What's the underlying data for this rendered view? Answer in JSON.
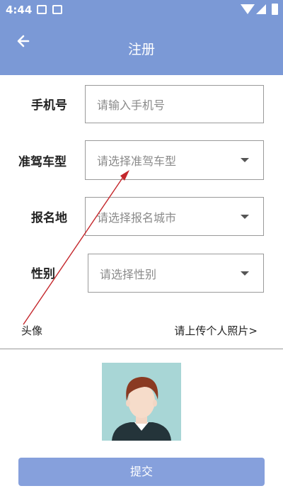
{
  "status_bar": {
    "time": "4:44"
  },
  "header": {
    "title": "注册"
  },
  "form": {
    "phone": {
      "label": "手机号",
      "placeholder": "请输入手机号"
    },
    "license": {
      "label": "准驾车型",
      "placeholder": "请选择准驾车型"
    },
    "city": {
      "label": "报名地",
      "placeholder": "请选择报名城市"
    },
    "gender": {
      "label": "性别",
      "placeholder": "请选择性别"
    }
  },
  "avatar_section": {
    "label": "头像",
    "upload_link": "请上传个人照片>"
  },
  "submit_label": "提交",
  "colors": {
    "header_bg": "#7b99d6",
    "button_bg": "#86a0dc",
    "annotation": "#c4262b"
  }
}
